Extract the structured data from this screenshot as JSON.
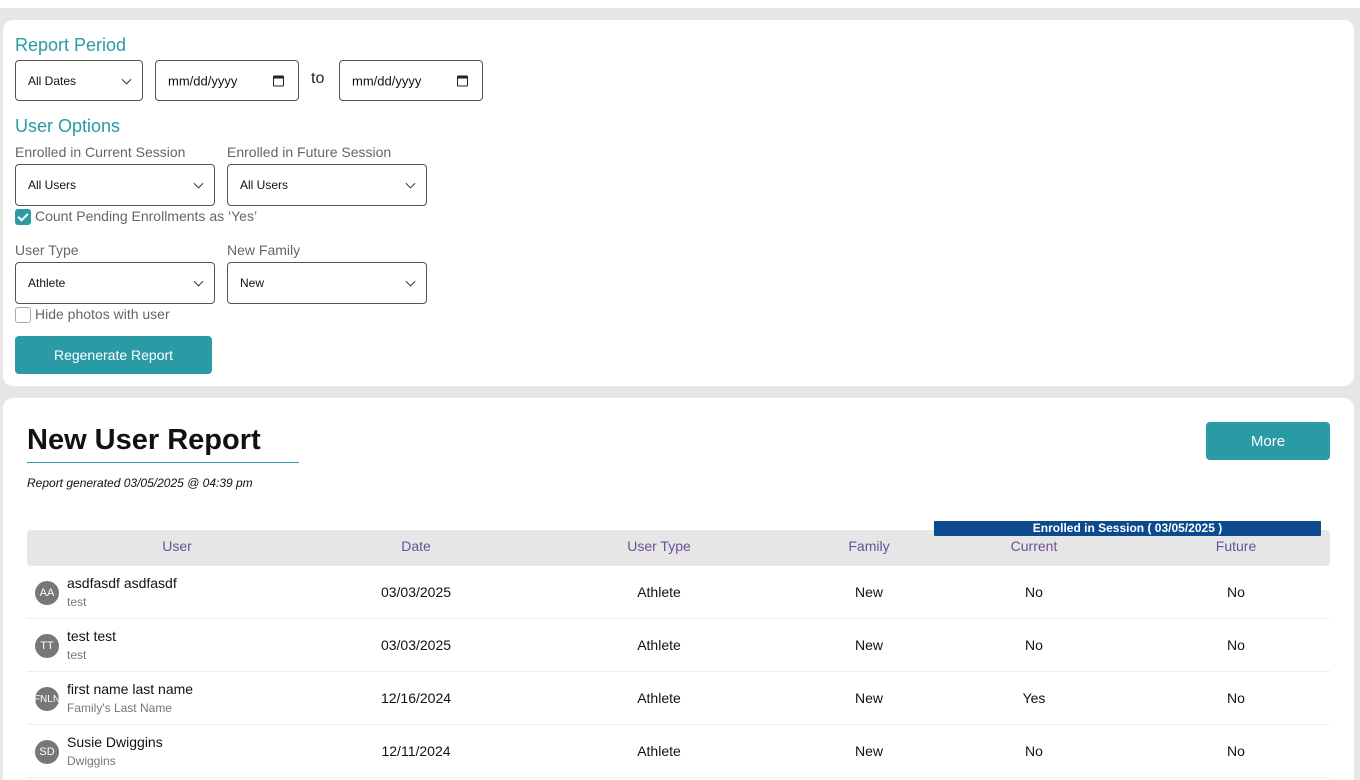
{
  "report_period": {
    "title": "Report Period",
    "date_range_select": "All Dates",
    "start_date_placeholder": "mm/dd/yyyy",
    "to_label": "to",
    "end_date_placeholder": "mm/dd/yyyy"
  },
  "user_options": {
    "title": "User Options",
    "current_session_label": "Enrolled in Current Session",
    "current_session_value": "All Users",
    "future_session_label": "Enrolled in Future Session",
    "future_session_value": "All Users",
    "count_pending_label": "Count Pending Enrollments as ‘Yes’",
    "count_pending_checked": true,
    "user_type_label": "User Type",
    "user_type_value": "Athlete",
    "new_family_label": "New Family",
    "new_family_value": "New",
    "hide_photos_label": "Hide photos with user",
    "hide_photos_checked": false,
    "regenerate_button": "Regenerate Report"
  },
  "report": {
    "title": "New User Report",
    "generated": "Report generated 03/05/2025 @ 04:39 pm",
    "more_button": "More",
    "enrolled_banner": "Enrolled in Session ( 03/05/2025 )",
    "columns": {
      "user": "User",
      "date": "Date",
      "user_type": "User Type",
      "family": "Family",
      "current": "Current",
      "future": "Future"
    },
    "rows": [
      {
        "initials": "AA",
        "name": "asdfasdf asdfasdf",
        "sub": "test",
        "date": "03/03/2025",
        "user_type": "Athlete",
        "family": "New",
        "current": "No",
        "future": "No"
      },
      {
        "initials": "TT",
        "name": "test test",
        "sub": "test",
        "date": "03/03/2025",
        "user_type": "Athlete",
        "family": "New",
        "current": "No",
        "future": "No"
      },
      {
        "initials": "FNLN",
        "name": "first name last name",
        "sub": "Family's Last Name",
        "date": "12/16/2024",
        "user_type": "Athlete",
        "family": "New",
        "current": "Yes",
        "future": "No"
      },
      {
        "initials": "SD",
        "name": "Susie Dwiggins",
        "sub": "Dwiggins",
        "date": "12/11/2024",
        "user_type": "Athlete",
        "family": "New",
        "current": "No",
        "future": "No"
      }
    ]
  },
  "colors": {
    "accent": "#2a9aa5",
    "banner": "#0c4a8e",
    "header_text": "#6a4f9a"
  }
}
